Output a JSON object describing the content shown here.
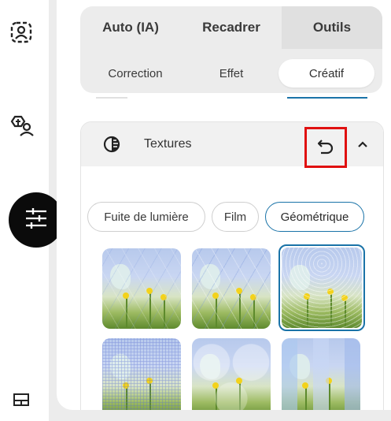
{
  "tabs": [
    {
      "label": "Auto (IA)",
      "active": false
    },
    {
      "label": "Recadrer",
      "active": false
    },
    {
      "label": "Outils",
      "active": true
    }
  ],
  "subtabs": [
    {
      "label": "Correction",
      "active": false
    },
    {
      "label": "Effet",
      "active": false
    },
    {
      "label": "Créatif",
      "active": true
    }
  ],
  "section": {
    "title": "Textures",
    "icon": "half-circle-icon",
    "reset_icon": "undo-icon",
    "collapse_icon": "chevron-up-icon"
  },
  "chips": [
    {
      "label": "Fuite de lumière",
      "active": false
    },
    {
      "label": "Film",
      "active": false
    },
    {
      "label": "Géométrique",
      "active": true
    }
  ],
  "thumbnails": [
    {
      "pattern": "triangles",
      "selected": false
    },
    {
      "pattern": "triangles-light",
      "selected": false
    },
    {
      "pattern": "waves",
      "selected": true
    },
    {
      "pattern": "grid-waves",
      "selected": false
    },
    {
      "pattern": "circles",
      "selected": false
    },
    {
      "pattern": "pixels",
      "selected": false
    }
  ],
  "sidebar": {
    "icons": [
      "portrait-frame-icon",
      "face-retouch-icon",
      "adjustments-icon",
      "layout-icon"
    ]
  },
  "colors": {
    "accent": "#1a73a8",
    "highlight": "#e01010",
    "fab": "#0b0b0b"
  }
}
